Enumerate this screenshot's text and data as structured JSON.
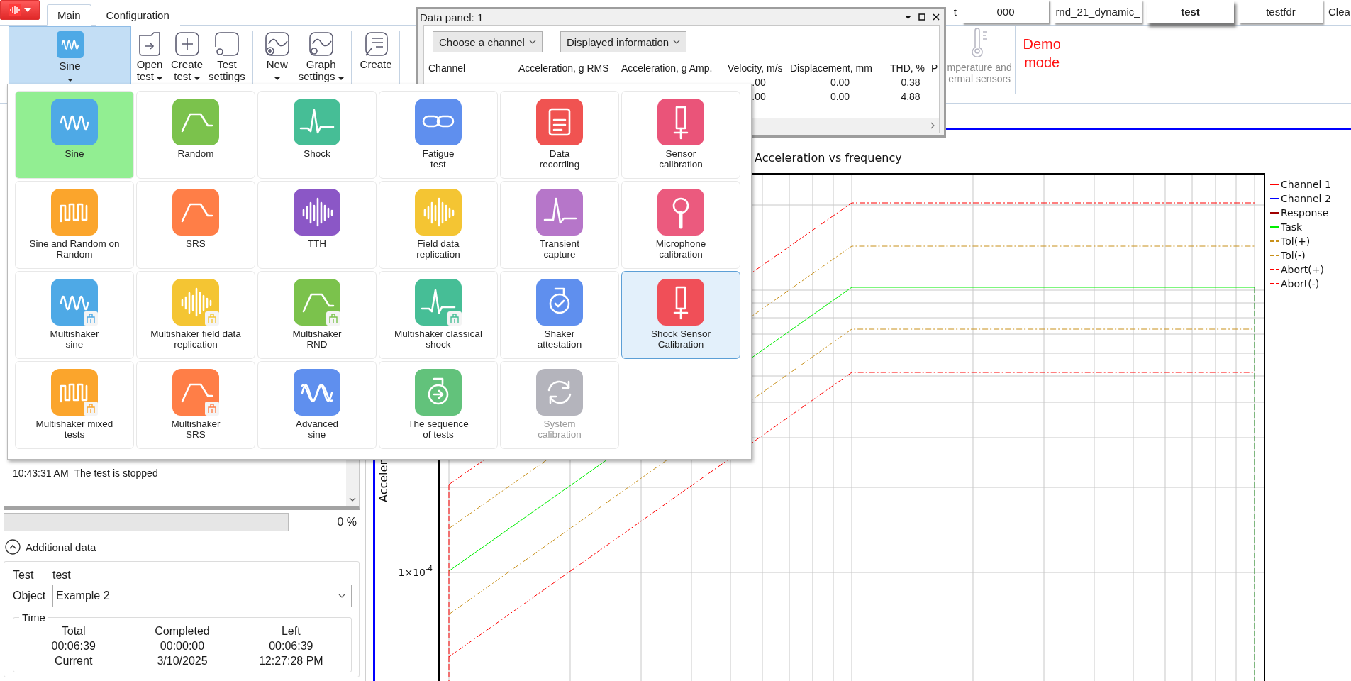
{
  "tabs": [
    {
      "label": "Main",
      "selected": true
    },
    {
      "label": "Configuration",
      "selected": false
    }
  ],
  "test_tabs": [
    {
      "label": "t",
      "selected": false
    },
    {
      "label": "000",
      "selected": false
    },
    {
      "label": "rnd_21_dynamic_",
      "selected": false
    },
    {
      "label": "test",
      "selected": true
    },
    {
      "label": "testfdr",
      "selected": false
    },
    {
      "label": "Clea",
      "selected": false
    }
  ],
  "ribbon": {
    "groups": [
      [
        {
          "label": "Sine",
          "dropdown": true,
          "selected": true
        },
        {
          "label": "Open\ntest",
          "dropdown": true,
          "selected": false
        },
        {
          "label": "Create\ntest",
          "dropdown": true,
          "selected": false
        },
        {
          "label": "Test\nsettings",
          "dropdown": false,
          "selected": false
        }
      ],
      [
        {
          "label": "New",
          "dropdown": true,
          "selected": false
        },
        {
          "label": "Graph\nsettings",
          "dropdown": true,
          "selected": false
        }
      ],
      [
        {
          "label": "Create",
          "dropdown": false,
          "selected": false
        }
      ]
    ],
    "sensors_button": {
      "label_lines": [
        "mperature and",
        "ermal sensors"
      ],
      "disabled": true
    },
    "mode_label": "Demo\nmode"
  },
  "data_panel": {
    "title": "Data panel: 1",
    "buttons": [
      "Choose a channel",
      "Displayed information"
    ],
    "columns": [
      "Channel",
      "Acceleration, g RMS",
      "Acceleration, g Amp.",
      "Velocity, m/s",
      "Displacement, mm",
      "THD, %",
      "P"
    ],
    "rows": [
      [
        ".00",
        "0.00",
        "0.38"
      ],
      [
        ".00",
        "0.00",
        "4.88"
      ]
    ]
  },
  "test_menu": {
    "items": [
      {
        "label": "Sine",
        "color": "#4ea9e6",
        "selected": true,
        "highlighted": false,
        "disabled": false,
        "badge": false
      },
      {
        "label": "Random",
        "color": "#7bc24c",
        "selected": false,
        "highlighted": false,
        "disabled": false,
        "badge": false
      },
      {
        "label": "Shock",
        "color": "#46be96",
        "selected": false,
        "highlighted": false,
        "disabled": false,
        "badge": false
      },
      {
        "label": "Fatigue\ntest",
        "color": "#5f8fee",
        "selected": false,
        "highlighted": false,
        "disabled": false,
        "badge": false
      },
      {
        "label": "Data\nrecording",
        "color": "#f05351",
        "selected": false,
        "highlighted": false,
        "disabled": false,
        "badge": false
      },
      {
        "label": "Sensor\ncalibration",
        "color": "#ea5479",
        "selected": false,
        "highlighted": false,
        "disabled": false,
        "badge": false
      },
      {
        "label": "Sine and Random on\nRandom",
        "color": "#fba52c",
        "selected": false,
        "highlighted": false,
        "disabled": false,
        "badge": false
      },
      {
        "label": "SRS",
        "color": "#ff7e47",
        "selected": false,
        "highlighted": false,
        "disabled": false,
        "badge": false
      },
      {
        "label": "TTH",
        "color": "#8b57c6",
        "selected": false,
        "highlighted": false,
        "disabled": false,
        "badge": false
      },
      {
        "label": "Field data\nreplication",
        "color": "#f4c533",
        "selected": false,
        "highlighted": false,
        "disabled": false,
        "badge": false
      },
      {
        "label": "Transient\ncapture",
        "color": "#b676c9",
        "selected": false,
        "highlighted": false,
        "disabled": false,
        "badge": false
      },
      {
        "label": "Microphone\ncalibration",
        "color": "#eb5a7e",
        "selected": false,
        "highlighted": false,
        "disabled": false,
        "badge": false
      },
      {
        "label": "Multishaker\nsine",
        "color": "#4ea9e6",
        "selected": false,
        "highlighted": false,
        "disabled": false,
        "badge": true
      },
      {
        "label": "Multishaker field data\nreplication",
        "color": "#f4c533",
        "selected": false,
        "highlighted": false,
        "disabled": false,
        "badge": true
      },
      {
        "label": "Multishaker\nRND",
        "color": "#7bc24c",
        "selected": false,
        "highlighted": false,
        "disabled": false,
        "badge": true
      },
      {
        "label": "Multishaker classical\nshock",
        "color": "#46be96",
        "selected": false,
        "highlighted": false,
        "disabled": false,
        "badge": true
      },
      {
        "label": "Shaker\nattestation",
        "color": "#5f8fee",
        "selected": false,
        "highlighted": false,
        "disabled": false,
        "badge": false
      },
      {
        "label": "Shock Sensor\nCalibration",
        "color": "#f04f58",
        "selected": false,
        "highlighted": true,
        "disabled": false,
        "badge": false
      },
      {
        "label": "Multishaker mixed\ntests",
        "color": "#fba52c",
        "selected": false,
        "highlighted": false,
        "disabled": false,
        "badge": true
      },
      {
        "label": "Multishaker\nSRS",
        "color": "#ff7e47",
        "selected": false,
        "highlighted": false,
        "disabled": false,
        "badge": true
      },
      {
        "label": "Advanced\nsine",
        "color": "#5f8fee",
        "selected": false,
        "highlighted": false,
        "disabled": false,
        "badge": false
      },
      {
        "label": "The sequence\nof tests",
        "color": "#62c27b",
        "selected": false,
        "highlighted": false,
        "disabled": false,
        "badge": false
      },
      {
        "label": "System\ncalibration",
        "color": "#b4b4bc",
        "selected": false,
        "highlighted": false,
        "disabled": true,
        "badge": false
      }
    ]
  },
  "log": [
    {
      "time": "10:43:31 AM",
      "message": "The test is stopped"
    }
  ],
  "progress": {
    "level": 0,
    "reading": "0 %"
  },
  "additional_data": {
    "label": "Additional data",
    "expanded": true,
    "test_label": "Test",
    "test_value": "test",
    "object_label": "Object",
    "object_value": "Example 2",
    "time": {
      "title": "Time",
      "rows": [
        [
          "Total",
          "Completed",
          "Left"
        ],
        [
          "00:06:39",
          "00:00:00",
          "00:06:39"
        ],
        [
          "Current",
          "3/10/2025",
          "12:27:28 PM"
        ]
      ]
    }
  },
  "chart": {
    "title": "Acceleration vs frequency",
    "y_label": "Acceler",
    "y_tick": {
      "base": "1×10",
      "exponent": "-4"
    },
    "legend": [
      {
        "label": "Channel 1",
        "color": "#ff0000",
        "kind": "solid"
      },
      {
        "label": "Channel 2",
        "color": "#0000ff",
        "kind": "solid"
      },
      {
        "label": "Response",
        "color": "#a00000",
        "kind": "solid"
      },
      {
        "label": "Task",
        "color": "#00ee00",
        "kind": "solid"
      },
      {
        "label": "Tol(+)",
        "color": "#c8901a",
        "kind": "dashed"
      },
      {
        "label": "Tol(-)",
        "color": "#c8901a",
        "kind": "dashed"
      },
      {
        "label": "Abort(+)",
        "color": "#ff0000",
        "kind": "dashed"
      },
      {
        "label": "Abort(-)",
        "color": "#ff0000",
        "kind": "dashed"
      }
    ]
  }
}
